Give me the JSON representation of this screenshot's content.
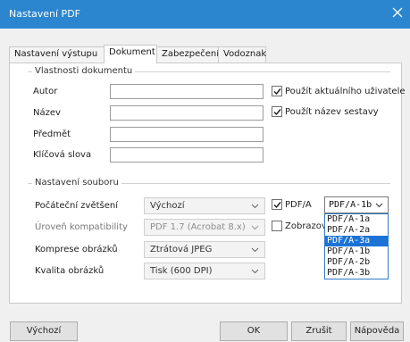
{
  "window": {
    "title": "Nastavení PDF"
  },
  "tabs": [
    {
      "label": "Nastavení výstupu"
    },
    {
      "label": "Dokument"
    },
    {
      "label": "Zabezpečení"
    },
    {
      "label": "Vodoznak"
    }
  ],
  "properties": {
    "group_title": "Vlastnosti dokumentu",
    "author_label": "Autor",
    "name_label": "Název",
    "subject_label": "Předmět",
    "keywords_label": "Klíčová slova",
    "use_current_user": {
      "label": "Použít aktuálního uživatele",
      "checked": true
    },
    "use_report_name": {
      "label": "Použít název sestavy",
      "checked": true
    }
  },
  "file": {
    "group_title": "Nastavení souboru",
    "initial_zoom_label": "Počáteční zvětšení",
    "initial_zoom_value": "Výchozí",
    "compat_label": "Úroveň kompatibility",
    "compat_value": "PDF 1.7 (Acrobat 8.x)",
    "compression_label": "Komprese obrázků",
    "compression_value": "Ztrátová JPEG",
    "quality_label": "Kvalita obrázků",
    "quality_value": "Tisk (600 DPI)",
    "pdfa": {
      "label": "PDF/A",
      "checked": true,
      "value": "PDF/A-1b"
    },
    "display": {
      "label": "Zobrazovat",
      "checked": false
    }
  },
  "pdfa_options": [
    "PDF/A-1a",
    "PDF/A-2a",
    "PDF/A-3a",
    "PDF/A-1b",
    "PDF/A-2b",
    "PDF/A-3b"
  ],
  "pdfa_highlighted": "PDF/A-3a",
  "buttons": {
    "default": "Výchozí",
    "ok": "OK",
    "cancel": "Zrušit",
    "help": "Nápověda"
  },
  "icons": {
    "close": "close-icon",
    "check": "checkmark-icon",
    "chevron": "chevron-down-icon"
  },
  "colors": {
    "titlebar": "#2b85cf",
    "highlight": "#1b73d6"
  }
}
